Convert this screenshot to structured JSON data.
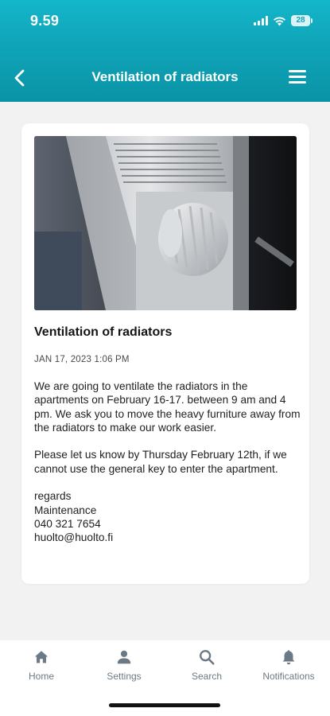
{
  "status_bar": {
    "time": "9.59",
    "battery_level": "28"
  },
  "nav": {
    "title": "Ventilation of radiators",
    "back_icon": "chevron-left-icon",
    "menu_icon": "hamburger-menu-icon"
  },
  "article": {
    "image_description": "radiator-photo",
    "title": "Ventilation of radiators",
    "date": "JAN 17, 2023 1:06 PM",
    "paragraph1": "We are going to ventilate the radiators in the apartments on February 16-17. between 9 am and 4 pm. We ask you to move the heavy furniture away from the radiators to make our work easier.",
    "paragraph2": "Please let us know by Thursday February 12th, if we cannot use the general key to enter the apartment.",
    "signature": [
      "regards",
      "Maintenance",
      "040 321 7654",
      "huolto@huolto.fi"
    ]
  },
  "tabs": [
    {
      "label": "Home",
      "icon": "home-icon"
    },
    {
      "label": "Settings",
      "icon": "person-icon"
    },
    {
      "label": "Search",
      "icon": "search-icon"
    },
    {
      "label": "Notifications",
      "icon": "bell-icon"
    }
  ],
  "colors": {
    "header_accent": "#0fa4b8",
    "tab_inactive": "#6b7a86"
  }
}
